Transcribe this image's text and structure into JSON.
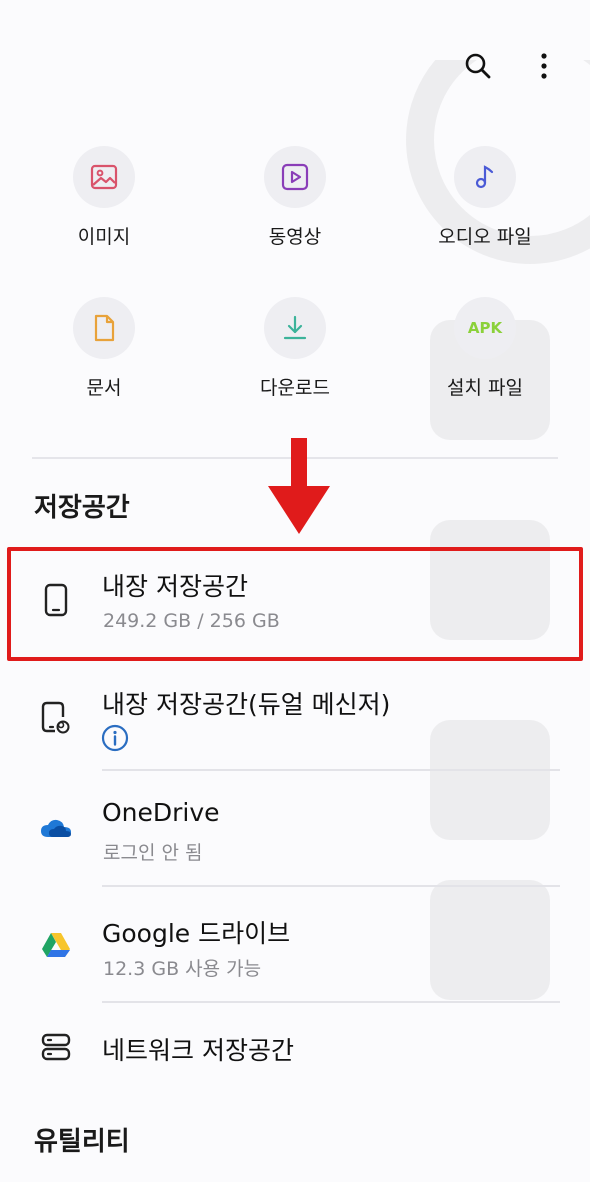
{
  "categories": [
    {
      "label": "이미지",
      "icon": "image-icon",
      "color": "#d9536b"
    },
    {
      "label": "동영상",
      "icon": "video-icon",
      "color": "#8a3db8"
    },
    {
      "label": "오디오 파일",
      "icon": "audio-icon",
      "color": "#4a5ad6"
    },
    {
      "label": "문서",
      "icon": "document-icon",
      "color": "#e8a23a"
    },
    {
      "label": "다운로드",
      "icon": "download-icon",
      "color": "#3cb39a"
    },
    {
      "label": "설치 파일",
      "icon": "apk-icon",
      "badge": "APK",
      "color": "#8bd13a"
    }
  ],
  "storage": {
    "title": "저장공간",
    "items": [
      {
        "title": "내장 저장공간",
        "subtitle": "249.2 GB / 256 GB",
        "icon": "phone-icon"
      },
      {
        "title": "내장 저장공간(듀얼 메신저)",
        "subtitle": "",
        "icon": "dual-messenger-phone-icon"
      },
      {
        "title": "OneDrive",
        "subtitle": "로그인 안 됨",
        "icon": "onedrive-icon"
      },
      {
        "title": "Google 드라이브",
        "subtitle": "12.3 GB 사용 가능",
        "icon": "google-drive-icon"
      },
      {
        "title": "네트워크 저장공간",
        "subtitle": "",
        "icon": "network-storage-icon"
      }
    ]
  },
  "utilities": {
    "title": "유틸리티"
  },
  "highlight_color": "#e01b1b"
}
